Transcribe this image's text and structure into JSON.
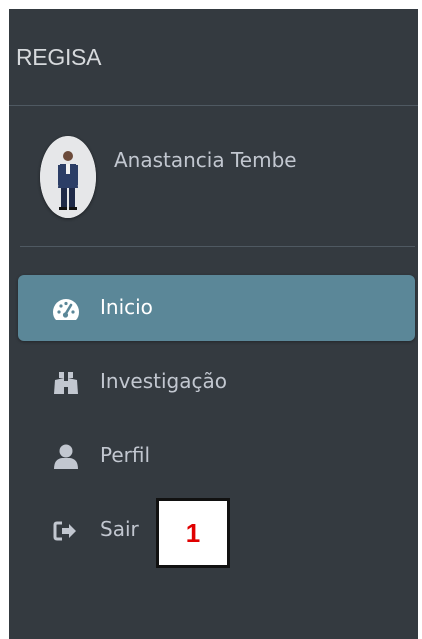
{
  "brand": {
    "title": "REGISA"
  },
  "user": {
    "name": "Anastancia Tembe",
    "avatar_icon": "user-photo"
  },
  "nav": {
    "items": [
      {
        "label": "Inicio",
        "icon": "tachometer-icon",
        "active": true
      },
      {
        "label": "Investigação",
        "icon": "binoculars-icon",
        "active": false
      },
      {
        "label": "Perfil",
        "icon": "user-icon",
        "active": false
      },
      {
        "label": "Sair",
        "icon": "sign-out-icon",
        "active": false
      }
    ]
  },
  "annotation": {
    "marker": "1"
  },
  "colors": {
    "sidebar": "#343a40",
    "active": "#5b8798",
    "text": "#c2c7d0",
    "marker": "#e00000"
  }
}
